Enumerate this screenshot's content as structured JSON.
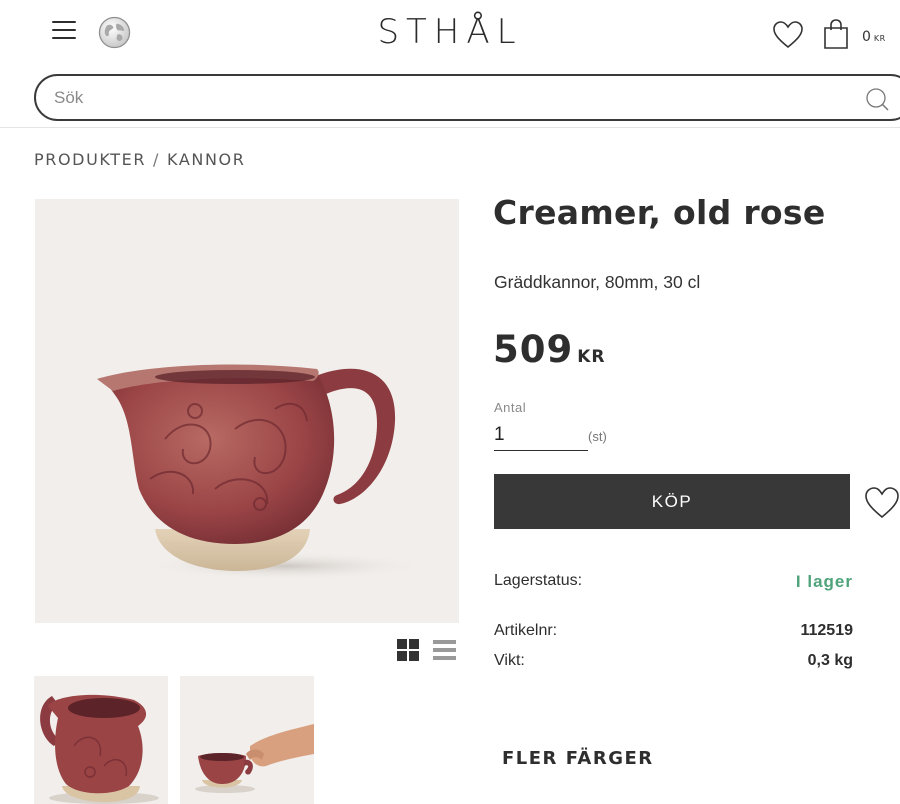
{
  "header": {
    "logo": "STHÅL",
    "cart_total": "0",
    "cart_currency": "KR"
  },
  "search": {
    "placeholder": "Sök"
  },
  "breadcrumb": [
    "PRODUKTER",
    "KANNOR"
  ],
  "product": {
    "title": "Creamer, old rose",
    "subtitle": "Gräddkannor, 80mm, 30 cl",
    "price": "509",
    "currency": "KR",
    "quantity_label": "Antal",
    "quantity_value": "1",
    "quantity_unit": "(st)",
    "buy_label": "KÖP",
    "stock_label": "Lagerstatus:",
    "stock_value": "I lager",
    "article_label": "Artikelnr:",
    "article_value": "112519",
    "weight_label": "Vikt:",
    "weight_value": "0,3 kg"
  },
  "more_colors": "FLER FÄRGER",
  "colors": {
    "button": "#383838",
    "in_stock": "#4fa37a",
    "image_bg": "#f1eeeb",
    "pitcher": "#9e4a4c"
  }
}
